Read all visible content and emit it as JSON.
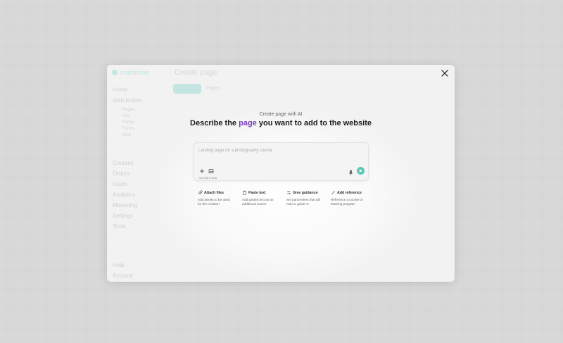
{
  "background_app": {
    "logo_text": "craftnomic",
    "title": "Create page",
    "tab_label": "Pages",
    "nav_primary": [
      "Home",
      "Web builder"
    ],
    "nav_sub": [
      "Pages",
      "Nav",
      "Footer",
      "Forms",
      "Blog"
    ],
    "nav_secondary": [
      "Courses",
      "Orders",
      "Users",
      "Analytics",
      "Marketing",
      "Settings",
      "Tools"
    ],
    "nav_bottom": [
      "Help",
      "Account"
    ]
  },
  "modal": {
    "eyebrow": "Create page with AI",
    "headline_before": "Describe the ",
    "headline_accent": "page",
    "headline_after": " you want to add to the website",
    "prompt": {
      "placeholder": "Landing page for a photography course",
      "value": "",
      "model_hint": "Currently in Beta"
    },
    "actions": [
      {
        "title": "Attach files",
        "description": "Add assets to be used for the creation",
        "icon": "paperclip-icon"
      },
      {
        "title": "Paste text",
        "description": "Add pasted text as an additional source",
        "icon": "clipboard-icon"
      },
      {
        "title": "Give guidance",
        "description": "Set parameters that will help to guide AI",
        "icon": "sliders-icon"
      },
      {
        "title": "Add reference",
        "description": "Reference a course or learning program",
        "icon": "link-icon"
      }
    ]
  },
  "colors": {
    "accent_purple": "#7a3fbe",
    "send_button": "#5cc7b2",
    "brand_teal": "#22b7a7"
  }
}
